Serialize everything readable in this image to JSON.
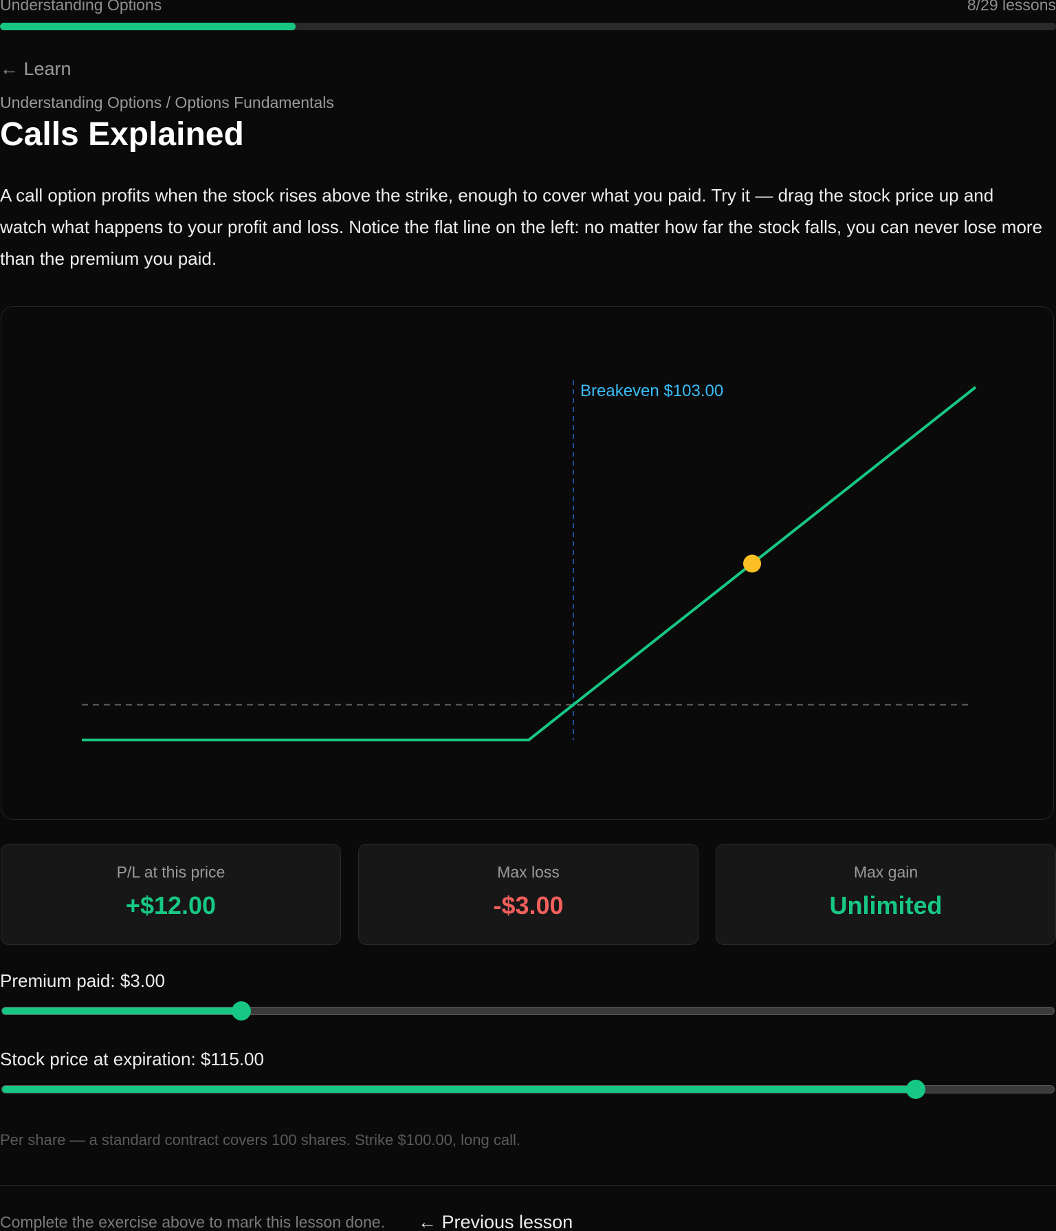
{
  "header": {
    "course_title": "Understanding Options",
    "lesson_count": "8/29 lessons",
    "progress_fraction": 0.28
  },
  "nav": {
    "back_label": "← Learn",
    "breadcrumb": "Understanding Options / Options Fundamentals",
    "previous_label": "← Previous lesson"
  },
  "lesson": {
    "title": "Calls Explained",
    "intro": "A call option profits when the stock rises above the strike, enough to cover what you paid. Try it — drag the stock price up and watch what happens to your profit and loss. Notice the flat line on the left: no matter how far the stock falls, you can never lose more than the premium you paid."
  },
  "chart_data": {
    "type": "line",
    "x": [
      70,
      100,
      130
    ],
    "series": [
      {
        "values": [
          -3,
          -3,
          27
        ]
      }
    ],
    "breakeven_label": "Breakeven $103.00",
    "breakeven_x": 103,
    "zero_line_y": 0,
    "marker": {
      "x": 115,
      "y": 12
    },
    "xlim": [
      70,
      130
    ],
    "ylim": [
      -3,
      27
    ],
    "grid": false,
    "colors": {
      "line": "#17c784",
      "marker": "#fbbf24",
      "breakeven": "#38bdf8",
      "breakeven_line": "#1e4fa3",
      "zero_line": "#5a5a5a"
    }
  },
  "stats": {
    "pl_label": "P/L at this price",
    "pl_value": "+$12.00",
    "max_loss_label": "Max loss",
    "max_loss_value": "-$3.00",
    "max_gain_label": "Max gain",
    "max_gain_value": "Unlimited"
  },
  "controls": {
    "premium_label": "Premium paid: $3.00",
    "premium_fraction": 0.228,
    "stock_label": "Stock price at expiration: $115.00",
    "stock_fraction": 0.868
  },
  "footnote": "Per share — a standard contract covers 100 shares. Strike $100.00, long call.",
  "footer": {
    "complete_note": "Complete the exercise above to mark this lesson done."
  },
  "colors": {
    "accent": "#17c784",
    "loss": "#f25f5c",
    "background": "#0a0a0a"
  }
}
